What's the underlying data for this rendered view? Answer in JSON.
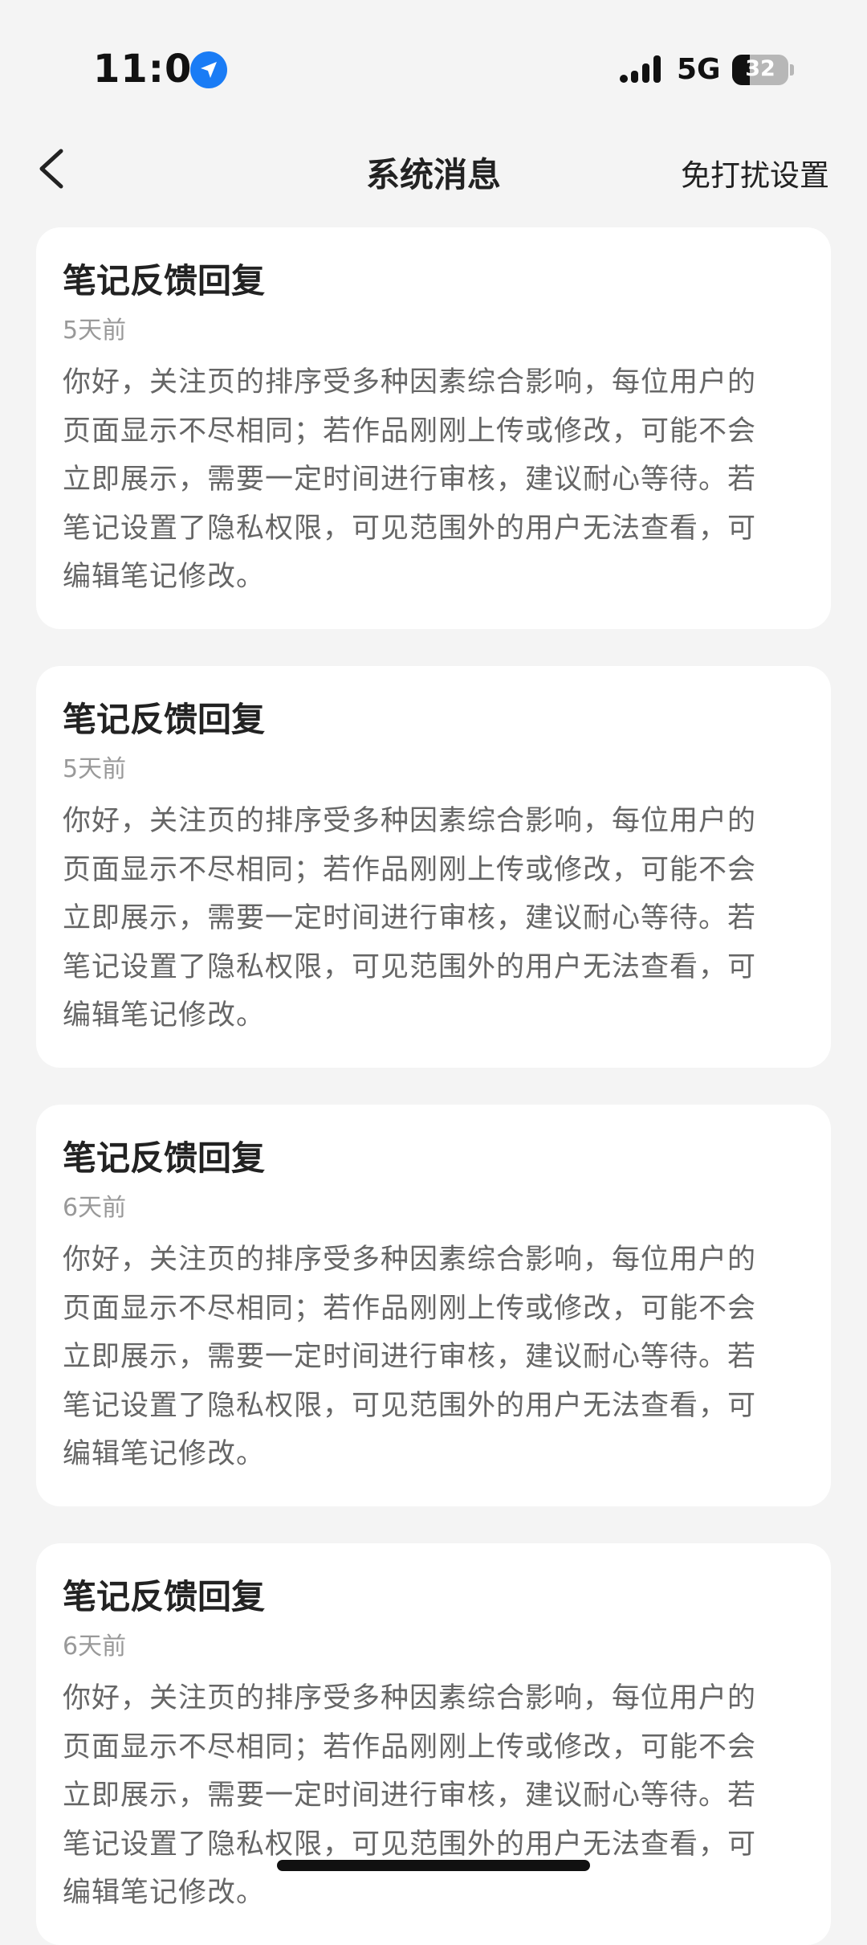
{
  "status_bar": {
    "time": "11:06",
    "network": "5G",
    "battery_level": "32",
    "battery_fraction": 0.32,
    "icons": [
      "location-arrow-icon",
      "signal-bars-icon",
      "battery-icon"
    ]
  },
  "nav": {
    "back_icon": "chevron-left-icon",
    "title": "系统消息",
    "right_action": "免打扰设置"
  },
  "messages": [
    {
      "title": "笔记反馈回复",
      "time": "5天前",
      "body": "你好，关注页的排序受多种因素综合影响，每位用户的\n页面显示不尽相同；若作品刚刚上传或修改，可能不会\n立即展示，需要一定时间进行审核，建议耐心等待。若\n笔记设置了隐私权限，可见范围外的用户无法查看，可\n编辑笔记修改。"
    },
    {
      "title": "笔记反馈回复",
      "time": "5天前",
      "body": "你好，关注页的排序受多种因素综合影响，每位用户的\n页面显示不尽相同；若作品刚刚上传或修改，可能不会\n立即展示，需要一定时间进行审核，建议耐心等待。若\n笔记设置了隐私权限，可见范围外的用户无法查看，可\n编辑笔记修改。"
    },
    {
      "title": "笔记反馈回复",
      "time": "6天前",
      "body": "你好，关注页的排序受多种因素综合影响，每位用户的\n页面显示不尽相同；若作品刚刚上传或修改，可能不会\n立即展示，需要一定时间进行审核，建议耐心等待。若\n笔记设置了隐私权限，可见范围外的用户无法查看，可\n编辑笔记修改。"
    },
    {
      "title": "笔记反馈回复",
      "time": "6天前",
      "body": "你好，关注页的排序受多种因素综合影响，每位用户的\n页面显示不尽相同；若作品刚刚上传或修改，可能不会\n立即展示，需要一定时间进行审核，建议耐心等待。若\n笔记设置了隐私权限，可见范围外的用户无法查看，可\n编辑笔记修改。"
    }
  ]
}
